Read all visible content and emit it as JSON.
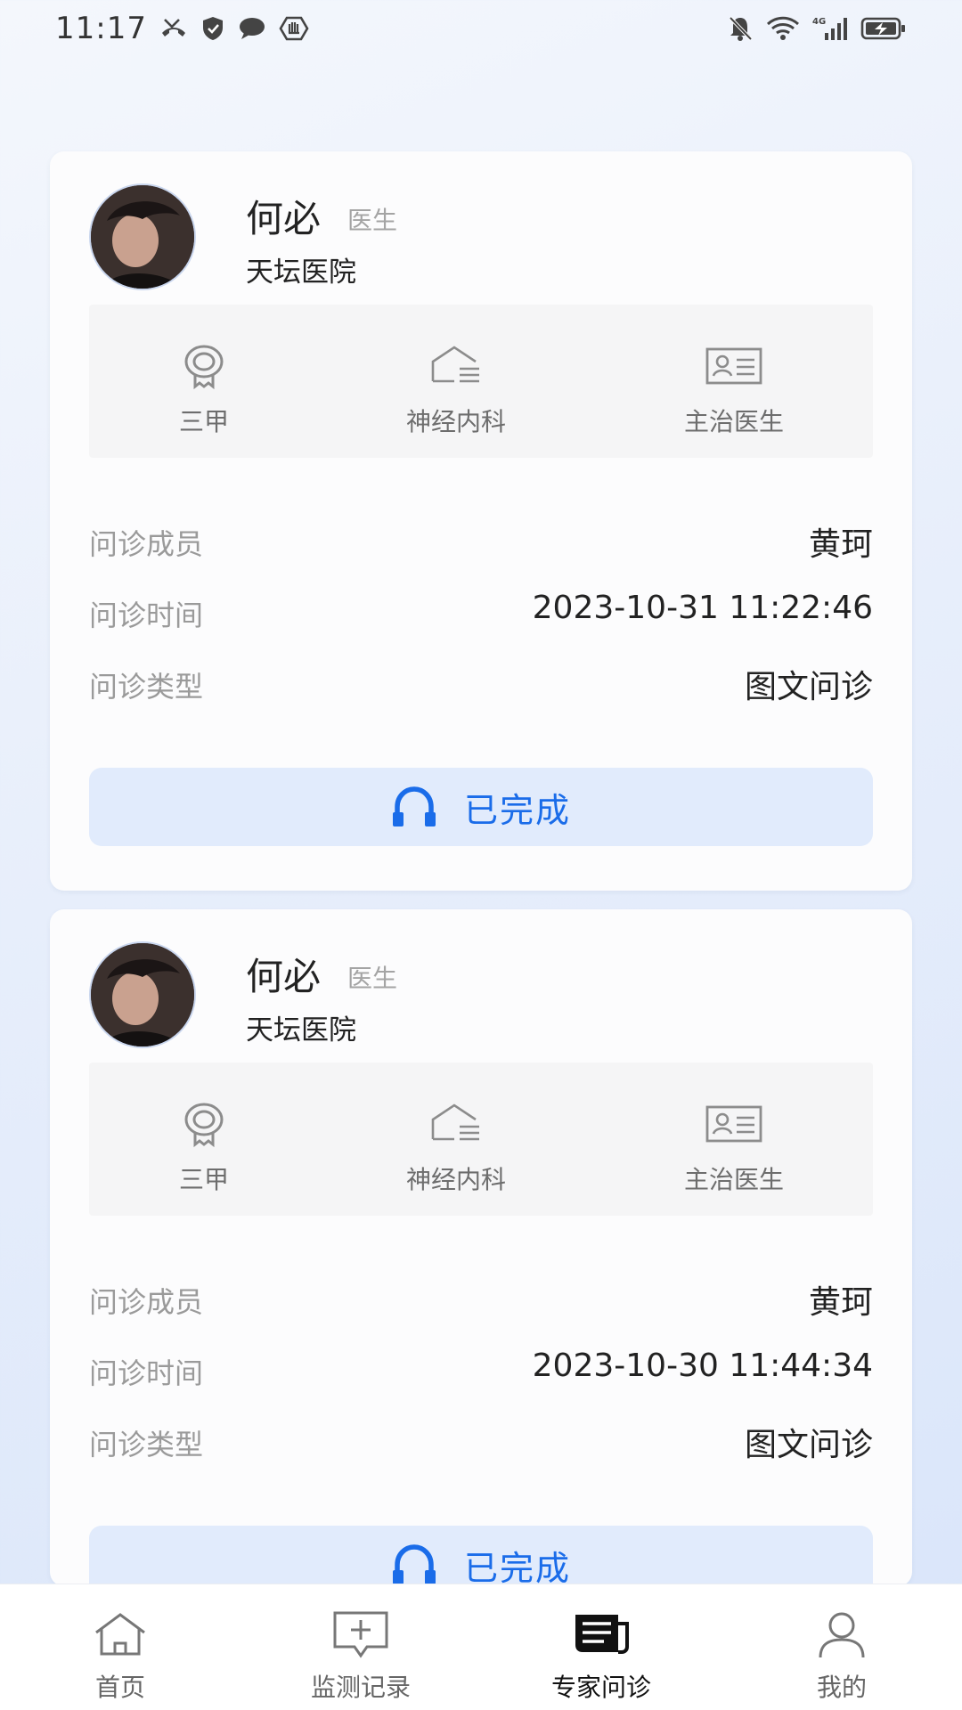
{
  "status_bar": {
    "time": "11:17",
    "network": "4G"
  },
  "consultations": [
    {
      "doctor_name": "何必",
      "doctor_title": "医生",
      "hospital": "天坛医院",
      "hospital_level": "三甲",
      "department": "神经内科",
      "position": "主治医生",
      "rows": [
        {
          "label": "问诊成员",
          "value": "黄珂"
        },
        {
          "label": "问诊时间",
          "value": "2023-10-31 11:22:46"
        },
        {
          "label": "问诊类型",
          "value": "图文问诊"
        }
      ],
      "status": "已完成"
    },
    {
      "doctor_name": "何必",
      "doctor_title": "医生",
      "hospital": "天坛医院",
      "hospital_level": "三甲",
      "department": "神经内科",
      "position": "主治医生",
      "rows": [
        {
          "label": "问诊成员",
          "value": "黄珂"
        },
        {
          "label": "问诊时间",
          "value": "2023-10-30 11:44:34"
        },
        {
          "label": "问诊类型",
          "value": "图文问诊"
        }
      ],
      "status": "已完成"
    }
  ],
  "bottom_nav": [
    {
      "label": "首页",
      "icon": "home-icon"
    },
    {
      "label": "监测记录",
      "icon": "monitor-record-icon"
    },
    {
      "label": "专家问诊",
      "icon": "expert-consult-icon",
      "active": true
    },
    {
      "label": "我的",
      "icon": "user-icon"
    }
  ],
  "colors": {
    "accent": "#1a6ce9",
    "button_bg": "#e1ebfc"
  }
}
